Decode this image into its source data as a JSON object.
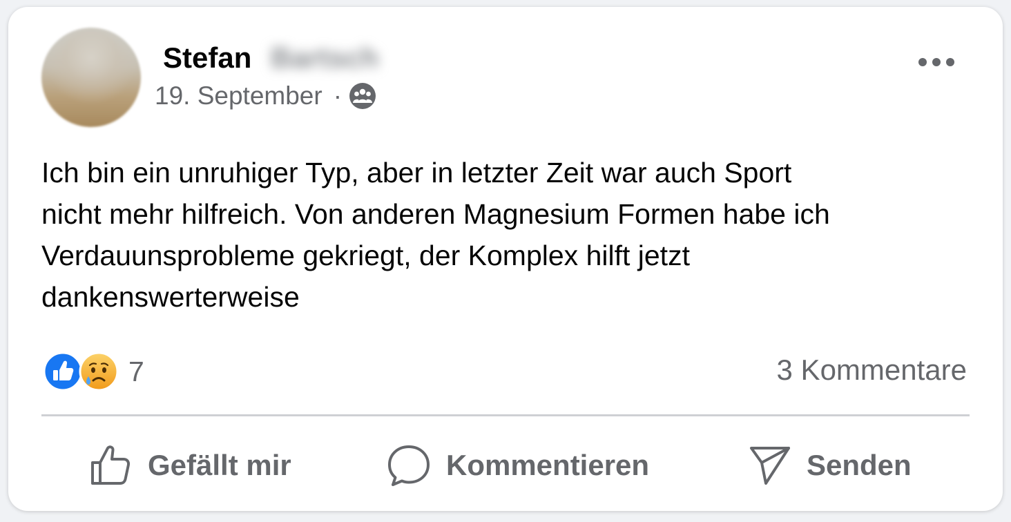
{
  "post": {
    "author_first": "Stefan",
    "author_last": "Bartsch",
    "date": "19. September",
    "separator": "·",
    "audience_icon": "group-icon",
    "text": "Ich bin ein unruhiger Typ, aber in letzter Zeit war auch Sport\nnicht mehr hilfreich. Von anderen Magnesium Formen habe ich\nVerdauunsprobleme gekriegt, der Komplex hilft jetzt\ndankenswerterweise"
  },
  "reactions": {
    "icons": [
      "like-reaction-icon",
      "sad-reaction-icon"
    ],
    "count": "7"
  },
  "comments": {
    "count_label": "3 Kommentare"
  },
  "actions": {
    "like_label": "Gefällt mir",
    "comment_label": "Kommentieren",
    "share_label": "Senden"
  },
  "colors": {
    "like_blue": "#1877f2",
    "secondary_text": "#65676b",
    "primary_text": "#050505",
    "sad_yellow": "#f7b125"
  }
}
